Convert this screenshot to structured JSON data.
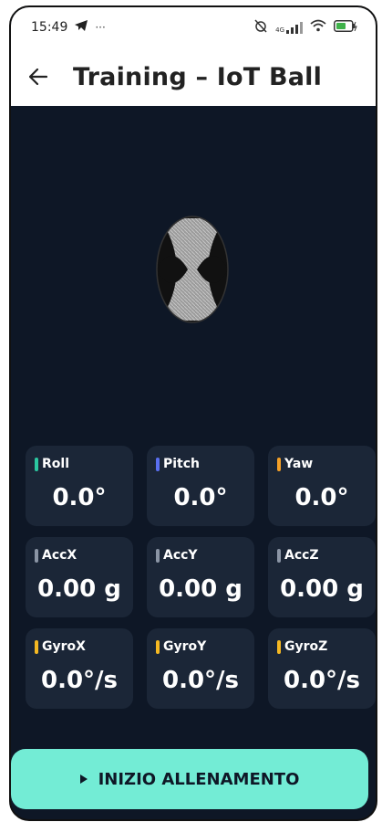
{
  "status": {
    "time": "15:49",
    "network": "4G"
  },
  "appbar": {
    "title": "Training – IoT Ball",
    "back_icon": "arrow-left-icon"
  },
  "ball": {
    "icon": "iot-ball-icon"
  },
  "sensors": [
    {
      "label": "Roll",
      "value": "0.0°",
      "color": "#2bc7a0"
    },
    {
      "label": "Pitch",
      "value": "0.0°",
      "color": "#5a6ff0"
    },
    {
      "label": "Yaw",
      "value": "0.0°",
      "color": "#f4a027"
    },
    {
      "label": "AccX",
      "value": "0.00 g",
      "color": "#8b95a5"
    },
    {
      "label": "AccY",
      "value": "0.00 g",
      "color": "#8b95a5"
    },
    {
      "label": "AccZ",
      "value": "0.00 g",
      "color": "#8b95a5"
    },
    {
      "label": "GyroX",
      "value": "0.0°/s",
      "color": "#f5b822"
    },
    {
      "label": "GyroY",
      "value": "0.0°/s",
      "color": "#f5b822"
    },
    {
      "label": "GyroZ",
      "value": "0.0°/s",
      "color": "#f5b822"
    }
  ],
  "start_button": {
    "label": "INIZIO ALLENAMENTO",
    "color": "#73ecd5"
  }
}
